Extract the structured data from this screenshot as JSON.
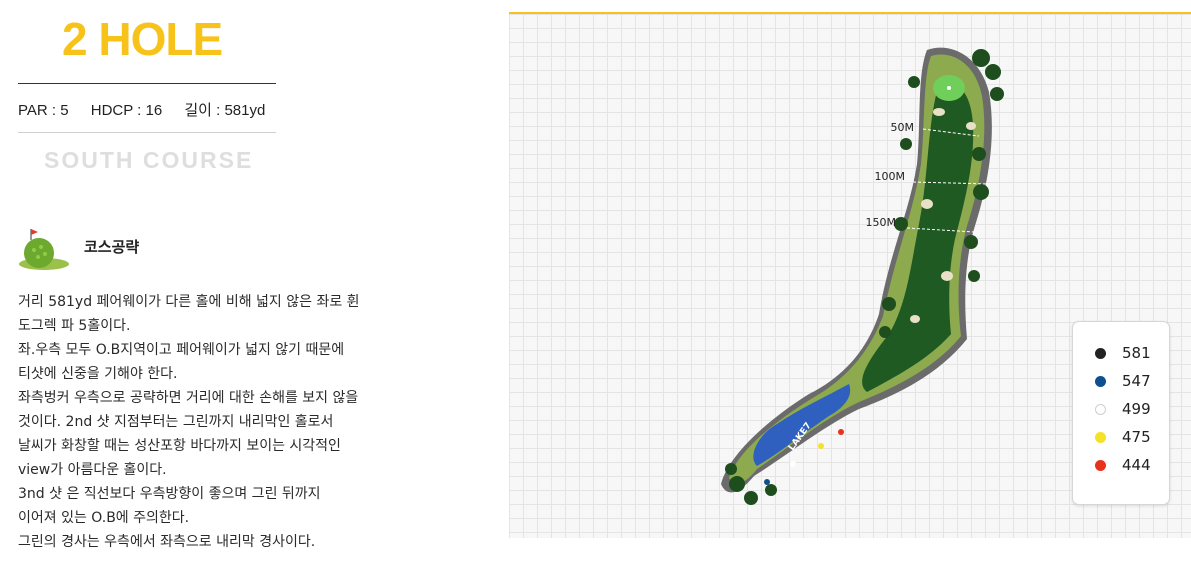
{
  "hole": {
    "title": "2 HOLE",
    "par": "PAR : 5",
    "hdcp": "HDCP : 16",
    "length": "길이 : 581yd",
    "course": "SOUTH COURSE"
  },
  "strategy": {
    "title": "코스공략",
    "icon": "golf-ball-flag-icon",
    "lines": [
      "거리 581yd 페어웨이가 다른 홀에 비해 넓지 않은 좌로 휜",
      "도그렉 파 5홀이다.",
      "좌.우측 모두 O.B지역이고 페어웨이가 넓지 않기 때문에",
      "티샷에 신중을 기해야 한다.",
      "좌측벙커 우측으로 공략하면 거리에 대한 손해를 보지 않을",
      "것이다. 2nd 샷 지점부터는 그린까지 내리막인 홀로서",
      "날씨가 화창할 때는 성산포항 바다까지 보이는 시각적인",
      "view가 아름다운 홀이다.",
      "3nd 샷 은 직선보다 우측방향이 좋으며 그린 뒤까지",
      "이어져 있는 O.B에 주의한다.",
      "그린의 경사는 우측에서 좌측으로 내리막 경사이다."
    ]
  },
  "map": {
    "distances": [
      "50M",
      "100M",
      "150M"
    ],
    "lake_label": "LAKE7"
  },
  "legend": [
    {
      "label": "581",
      "color": "#222222"
    },
    {
      "label": "547",
      "color": "#0e4f8f"
    },
    {
      "label": "499",
      "color": "#ffffff"
    },
    {
      "label": "475",
      "color": "#f5e02a"
    },
    {
      "label": "444",
      "color": "#e8321c"
    }
  ],
  "colors": {
    "accent": "#f7c31a",
    "rough": "#7f9e45",
    "fairway": "#1f5a22",
    "water": "#2f5fbf"
  }
}
